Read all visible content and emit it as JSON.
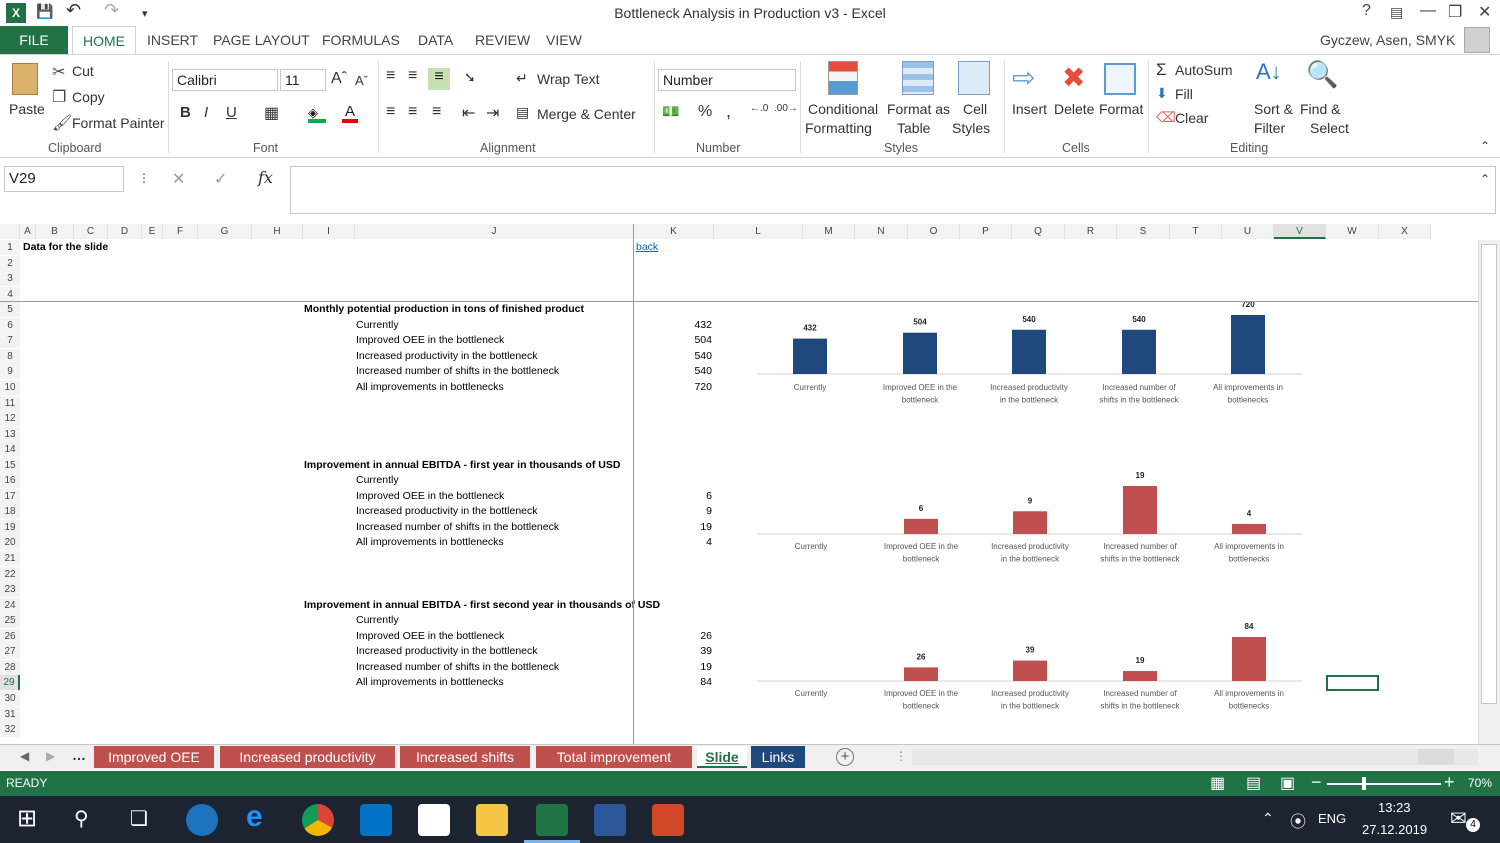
{
  "window": {
    "title": "Bottleneck Analysis in Production v3 - Excel",
    "help": "?",
    "user": "Gyczew, Asen, SMYK"
  },
  "tabs": [
    "FILE",
    "HOME",
    "INSERT",
    "PAGE LAYOUT",
    "FORMULAS",
    "DATA",
    "REVIEW",
    "VIEW"
  ],
  "ribbon": {
    "clipboard": {
      "paste": "Paste",
      "cut": "Cut",
      "copy": "Copy",
      "painter": "Format Painter",
      "group": "Clipboard"
    },
    "font": {
      "name": "Calibri",
      "size": "11",
      "group": "Font"
    },
    "alignment": {
      "wrap": "Wrap Text",
      "merge": "Merge & Center",
      "group": "Alignment"
    },
    "number": {
      "format": "Number",
      "group": "Number"
    },
    "styles": {
      "cond1": "Conditional",
      "cond2": "Formatting",
      "fmt1": "Format as",
      "fmt2": "Table",
      "cell1": "Cell",
      "cell2": "Styles",
      "group": "Styles"
    },
    "cells": {
      "insert": "Insert",
      "delete": "Delete",
      "format": "Format",
      "group": "Cells"
    },
    "editing": {
      "autosum": "AutoSum",
      "fill": "Fill",
      "clear": "Clear",
      "sort1": "Sort &",
      "sort2": "Filter",
      "find1": "Find &",
      "find2": "Select",
      "group": "Editing"
    }
  },
  "formula_bar": {
    "name_box": "V29",
    "formula": ""
  },
  "columns": [
    "A",
    "B",
    "C",
    "D",
    "E",
    "F",
    "G",
    "H",
    "I",
    "J",
    "K",
    "L",
    "M",
    "N",
    "O",
    "P",
    "Q",
    "R",
    "S",
    "T",
    "U",
    "V",
    "W",
    "X"
  ],
  "rows": [
    "1",
    "2",
    "3",
    "4",
    "5",
    "6",
    "7",
    "8",
    "9",
    "10",
    "11",
    "12",
    "13",
    "14",
    "15",
    "16",
    "17",
    "18",
    "19",
    "20",
    "21",
    "22",
    "23",
    "24",
    "25",
    "26",
    "27",
    "28",
    "29",
    "30",
    "31",
    "32"
  ],
  "sheet": {
    "a1": "Data for the slide",
    "back": "back",
    "sections": [
      {
        "title": "Monthly potential production in tons of finished product",
        "items": [
          {
            "label": "Currently",
            "value": "432"
          },
          {
            "label": "Improved OEE in the bottleneck",
            "value": "504"
          },
          {
            "label": "Increased productivity in the bottleneck",
            "value": "540"
          },
          {
            "label": "Increased number of shifts in the bottleneck",
            "value": "540"
          },
          {
            "label": "All improvements in bottlenecks",
            "value": "720"
          }
        ]
      },
      {
        "title": "Improvement in annual EBITDA - first year in thousands of USD",
        "items": [
          {
            "label": "Currently",
            "value": ""
          },
          {
            "label": "Improved OEE in the bottleneck",
            "value": "6"
          },
          {
            "label": "Increased productivity in the bottleneck",
            "value": "9"
          },
          {
            "label": "Increased number of shifts in the bottleneck",
            "value": "19"
          },
          {
            "label": "All improvements in bottlenecks",
            "value": "4"
          }
        ]
      },
      {
        "title": "Improvement in annual EBITDA - first second year in thousands of USD",
        "items": [
          {
            "label": "Currently",
            "value": ""
          },
          {
            "label": "Improved OEE in the bottleneck",
            "value": "26"
          },
          {
            "label": "Increased productivity in the bottleneck",
            "value": "39"
          },
          {
            "label": "Increased number of shifts in the bottleneck",
            "value": "19"
          },
          {
            "label": "All improvements in bottlenecks",
            "value": "84"
          }
        ]
      }
    ]
  },
  "chart_data": [
    {
      "type": "bar",
      "color": "#1f497d",
      "categories": [
        "Currently",
        "Improved OEE in the bottleneck",
        "Increased productivity in the bottleneck",
        "Increased number of shifts in the bottleneck",
        "All improvements in bottlenecks"
      ],
      "values": [
        432,
        504,
        540,
        540,
        720
      ]
    },
    {
      "type": "bar",
      "color": "#c0504d",
      "categories": [
        "Currently",
        "Improved OEE in the bottleneck",
        "Increased productivity in the bottleneck",
        "Increased number of shifts in the bottleneck",
        "All improvements in bottlenecks"
      ],
      "values": [
        null,
        6,
        9,
        19,
        4
      ]
    },
    {
      "type": "bar",
      "color": "#c0504d",
      "categories": [
        "Currently",
        "Improved OEE in the bottleneck",
        "Increased productivity in the bottleneck",
        "Increased number of shifts in the bottleneck",
        "All improvements in bottlenecks"
      ],
      "values": [
        null,
        26,
        39,
        19,
        84
      ]
    }
  ],
  "sheet_tabs": [
    {
      "label": "Improved OEE",
      "color": "#c0504d"
    },
    {
      "label": "Increased productivity",
      "color": "#c0504d"
    },
    {
      "label": "Increased shifts",
      "color": "#c0504d"
    },
    {
      "label": "Total improvement",
      "color": "#c0504d"
    },
    {
      "label": "Slide",
      "color": "#ffffff",
      "active": true
    },
    {
      "label": "Links",
      "color": "#1f497d"
    }
  ],
  "status": {
    "ready": "READY",
    "zoom": "70%"
  },
  "taskbar": {
    "lang": "ENG",
    "time": "13:23",
    "date": "27.12.2019",
    "notif": "4"
  }
}
